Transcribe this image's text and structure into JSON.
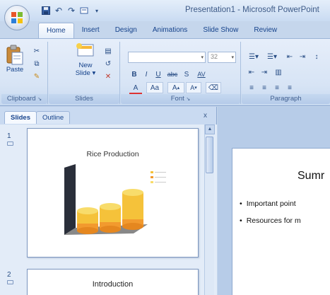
{
  "window": {
    "title": "Presentation1 - Microsoft PowerPoint"
  },
  "quick_access": {
    "save_icon": "save-icon",
    "undo_icon": "undo-icon",
    "redo_icon": "redo-icon"
  },
  "ribbon_tabs": [
    "Home",
    "Insert",
    "Design",
    "Animations",
    "Slide Show",
    "Review"
  ],
  "clipboard": {
    "paste_label": "Paste",
    "group_label": "Clipboard"
  },
  "slides_group": {
    "new_slide_label_1": "New",
    "new_slide_label_2": "Slide",
    "group_label": "Slides"
  },
  "font_group": {
    "font_size": "32",
    "bold": "B",
    "italic": "I",
    "underline": "U",
    "strike": "abc",
    "shadow": "S",
    "spacing": "AV",
    "font_color": "A",
    "change_case": "Aa",
    "grow": "A",
    "shrink": "A",
    "group_label": "Font"
  },
  "paragraph_group": {
    "group_label": "Paragraph"
  },
  "pane": {
    "tab_slides": "Slides",
    "tab_outline": "Outline",
    "close": "x"
  },
  "slides": [
    {
      "number": "1",
      "title": "Rice Production"
    },
    {
      "number": "2",
      "title": "Introduction"
    }
  ],
  "main_slide": {
    "title": "Sumr",
    "bullets": [
      "Important point",
      "Resources for m"
    ]
  },
  "colors": {
    "ribbon_bg": "#dbe7f7",
    "accent": "#15428b",
    "cylinder_yellow": "#f2d24a",
    "cylinder_orange": "#f5a03a"
  }
}
